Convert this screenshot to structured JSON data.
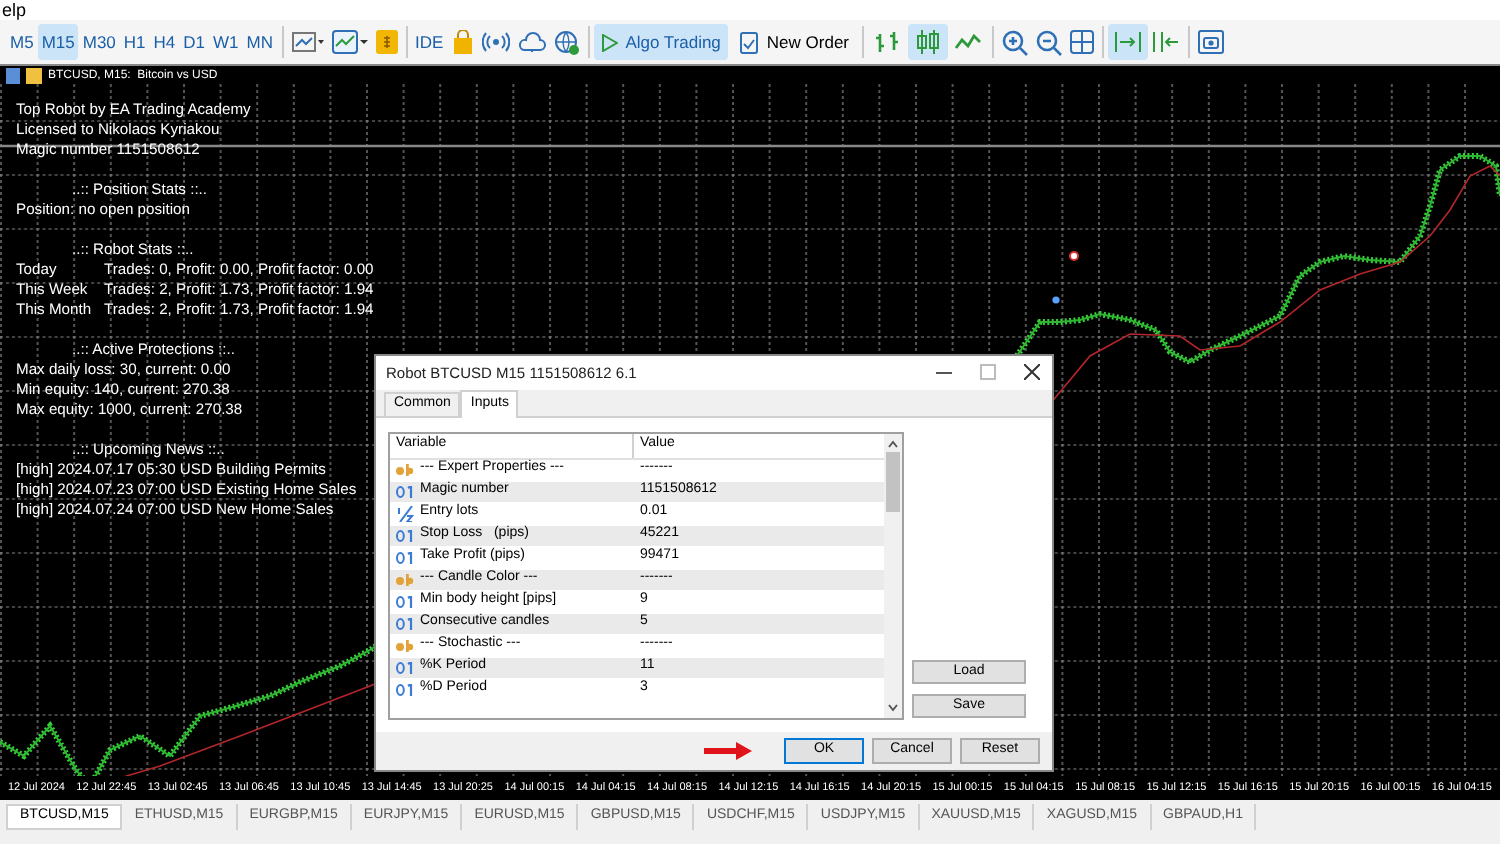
{
  "menu_bar": {
    "visible_text": "elp"
  },
  "toolbar": {
    "timeframes": [
      {
        "label": "M5",
        "selected": false
      },
      {
        "label": "M15",
        "selected": true
      },
      {
        "label": "M30",
        "selected": false
      },
      {
        "label": "H1",
        "selected": false
      },
      {
        "label": "H4",
        "selected": false
      },
      {
        "label": "D1",
        "selected": false
      },
      {
        "label": "W1",
        "selected": false
      },
      {
        "label": "MN",
        "selected": false
      }
    ],
    "ide_label": "IDE",
    "algo_trading": {
      "label": "Algo Trading",
      "on": true
    },
    "new_order": "New Order",
    "chart_types": [
      {
        "kind": "bars",
        "selected": false
      },
      {
        "kind": "candles",
        "selected": true
      },
      {
        "kind": "line",
        "selected": false
      }
    ],
    "autoscroll": {
      "on": true
    }
  },
  "chart": {
    "title": "BTCUSD, M15:  Bitcoin vs USD",
    "info_lines": [
      "Top Robot by EA Trading Academy",
      "Licensed to Nikolaos Kyriakou",
      "Magic number 1151508612"
    ],
    "sections": [
      {
        "title": "..:: Position Stats ::..",
        "lines": [
          {
            "text": "Position: no open position"
          }
        ]
      },
      {
        "title": "..:: Robot Stats ::..",
        "lines": [
          {
            "period": "Today",
            "text": "Trades: 0, Profit: 0.00, Profit factor: 0.00"
          },
          {
            "period": "This Week",
            "text": "Trades: 2, Profit: 1.73, Profit factor: 1.94"
          },
          {
            "period": "This Month",
            "text": "Trades: 2, Profit: 1.73, Profit factor: 1.94"
          }
        ]
      },
      {
        "title": "..:: Active Protections ::..",
        "lines": [
          {
            "text": "Max daily loss: 30, current: 0.00"
          },
          {
            "text": "Min equity: 140, current: 270.38"
          },
          {
            "text": "Max equity: 1000, current: 270.38"
          }
        ]
      },
      {
        "title": "..:: Upcoming News ::..",
        "lines": [
          {
            "text": "[high] 2024.07.17 05:30 USD Building Permits"
          },
          {
            "text": "[high] 2024.07.23 07:00 USD Existing Home Sales"
          },
          {
            "text": "[high] 2024.07.24 07:00 USD New Home Sales"
          }
        ]
      }
    ],
    "time_axis": [
      "12 Jul 2024",
      "12 Jul 22:45",
      "13 Jul 02:45",
      "13 Jul 06:45",
      "13 Jul 10:45",
      "13 Jul 14:45",
      "13 Jul 20:25",
      "14 Jul 00:15",
      "14 Jul 04:15",
      "14 Jul 08:15",
      "14 Jul 12:15",
      "14 Jul 16:15",
      "14 Jul 20:15",
      "15 Jul 00:15",
      "15 Jul 04:15",
      "15 Jul 08:15",
      "15 Jul 12:15",
      "15 Jul 16:15",
      "15 Jul 20:15",
      "16 Jul 00:15",
      "16 Jul 04:15"
    ]
  },
  "dialog": {
    "title": "Robot BTCUSD M15 1151508612 6.1",
    "tabs": [
      {
        "label": "Common",
        "selected": false
      },
      {
        "label": "Inputs",
        "selected": true
      }
    ],
    "columns": [
      "Variable",
      "Value"
    ],
    "rows": [
      {
        "kind": "string",
        "variable": "--- Expert Properties ---",
        "value": "-------"
      },
      {
        "kind": "integer",
        "variable": "Magic number",
        "value": "1151508612"
      },
      {
        "kind": "double",
        "variable": "Entry lots",
        "value": "0.01"
      },
      {
        "kind": "integer",
        "variable": "Stop Loss   (pips)",
        "value": "45221"
      },
      {
        "kind": "integer",
        "variable": "Take Profit (pips)",
        "value": "99471"
      },
      {
        "kind": "string",
        "variable": "--- Candle Color ---",
        "value": "-------"
      },
      {
        "kind": "integer",
        "variable": "Min body height [pips]",
        "value": "9"
      },
      {
        "kind": "integer",
        "variable": "Consecutive candles",
        "value": "5"
      },
      {
        "kind": "string",
        "variable": "--- Stochastic ---",
        "value": "-------"
      },
      {
        "kind": "integer",
        "variable": "%K Period",
        "value": "11"
      },
      {
        "kind": "integer",
        "variable": "%D Period",
        "value": "3"
      }
    ],
    "side_buttons": [
      "Load",
      "Save"
    ],
    "bottom_buttons": [
      {
        "label": "OK",
        "focused": true
      },
      {
        "label": "Cancel",
        "focused": false
      },
      {
        "label": "Reset",
        "focused": false
      }
    ]
  },
  "symbol_tabs": [
    {
      "label": "BTCUSD,M15",
      "selected": true
    },
    {
      "label": "ETHUSD,M15",
      "selected": false
    },
    {
      "label": "EURGBP,M15",
      "selected": false
    },
    {
      "label": "EURJPY,M15",
      "selected": false
    },
    {
      "label": "EURUSD,M15",
      "selected": false
    },
    {
      "label": "GBPUSD,M15",
      "selected": false
    },
    {
      "label": "USDCHF,M15",
      "selected": false
    },
    {
      "label": "USDJPY,M15",
      "selected": false
    },
    {
      "label": "XAUUSD,M15",
      "selected": false
    },
    {
      "label": "XAGUSD,M15",
      "selected": false
    },
    {
      "label": "GBPAUD,H1",
      "selected": false
    }
  ]
}
